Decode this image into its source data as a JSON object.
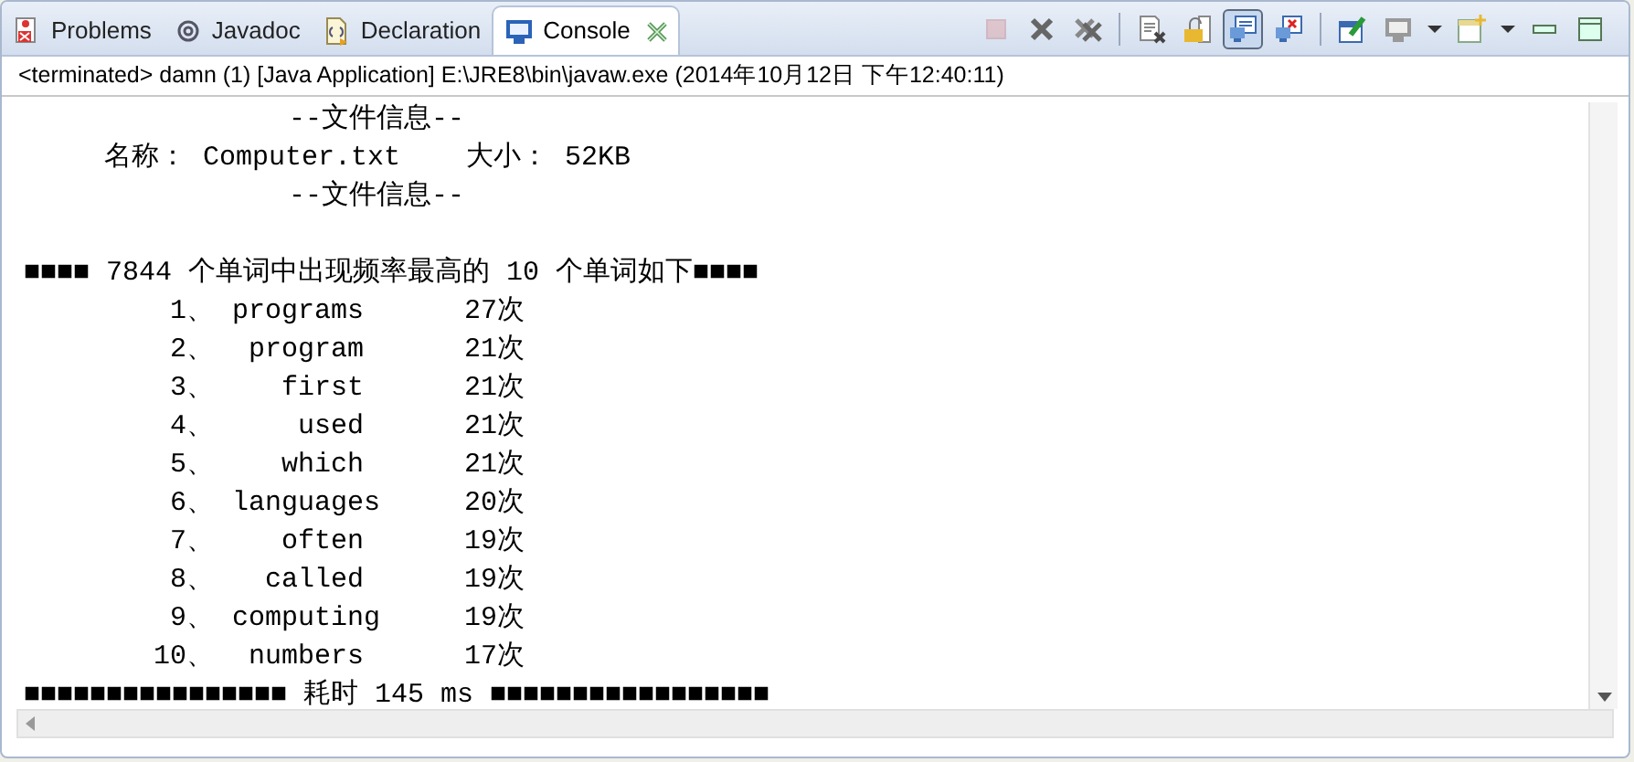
{
  "tabs": [
    {
      "label": "Problems",
      "kind": "problems",
      "selected": false
    },
    {
      "label": "Javadoc",
      "kind": "javadoc",
      "selected": false
    },
    {
      "label": "Declaration",
      "kind": "declaration",
      "selected": false
    },
    {
      "label": "Console",
      "kind": "console",
      "selected": true
    }
  ],
  "toolbar": [
    [
      {
        "kind": "terminate",
        "disabled": true,
        "pressed": false
      },
      {
        "kind": "remove",
        "disabled": false,
        "pressed": false
      },
      {
        "kind": "remove-all",
        "disabled": false,
        "pressed": false
      }
    ],
    [
      {
        "kind": "clear",
        "disabled": false,
        "pressed": false
      },
      {
        "kind": "scroll-lock",
        "disabled": false,
        "pressed": false
      },
      {
        "kind": "show-out",
        "disabled": false,
        "pressed": true
      },
      {
        "kind": "show-err",
        "disabled": false,
        "pressed": false
      }
    ],
    [
      {
        "kind": "pin",
        "disabled": false,
        "pressed": false
      },
      {
        "kind": "display",
        "disabled": false,
        "pressed": false
      },
      {
        "kind": "dropdown",
        "disabled": false,
        "pressed": false
      },
      {
        "kind": "open",
        "disabled": false,
        "pressed": false
      },
      {
        "kind": "dropdown",
        "disabled": false,
        "pressed": false
      },
      {
        "kind": "minimize",
        "disabled": false,
        "pressed": false
      },
      {
        "kind": "maximize",
        "disabled": false,
        "pressed": false
      }
    ]
  ],
  "process": "<terminated> damn (1) [Java Application] E:\\JRE8\\bin\\javaw.exe (2014年10月12日 下午12:40:11)",
  "console": {
    "header": "--文件信息--",
    "file_name": "名称： Computer.txt",
    "file_size": "大小： 52KB",
    "footer": "--文件信息--",
    "summary": "■■■■ 7844 个单词中出现频率最高的 10 个单词如下■■■■",
    "rows": [
      {
        "rank": "1、",
        "word": "programs",
        "count": "27次"
      },
      {
        "rank": "2、",
        "word": "program",
        "count": "21次"
      },
      {
        "rank": "3、",
        "word": "first",
        "count": "21次"
      },
      {
        "rank": "4、",
        "word": "used",
        "count": "21次"
      },
      {
        "rank": "5、",
        "word": "which",
        "count": "21次"
      },
      {
        "rank": "6、",
        "word": "languages",
        "count": "20次"
      },
      {
        "rank": "7、",
        "word": "often",
        "count": "19次"
      },
      {
        "rank": "8、",
        "word": "called",
        "count": "19次"
      },
      {
        "rank": "9、",
        "word": "computing",
        "count": "19次"
      },
      {
        "rank": "10、",
        "word": "numbers",
        "count": "17次"
      }
    ],
    "timing": "■■■■■■■■■■■■■■■■ 耗时 145 ms ■■■■■■■■■■■■■■■■■"
  }
}
